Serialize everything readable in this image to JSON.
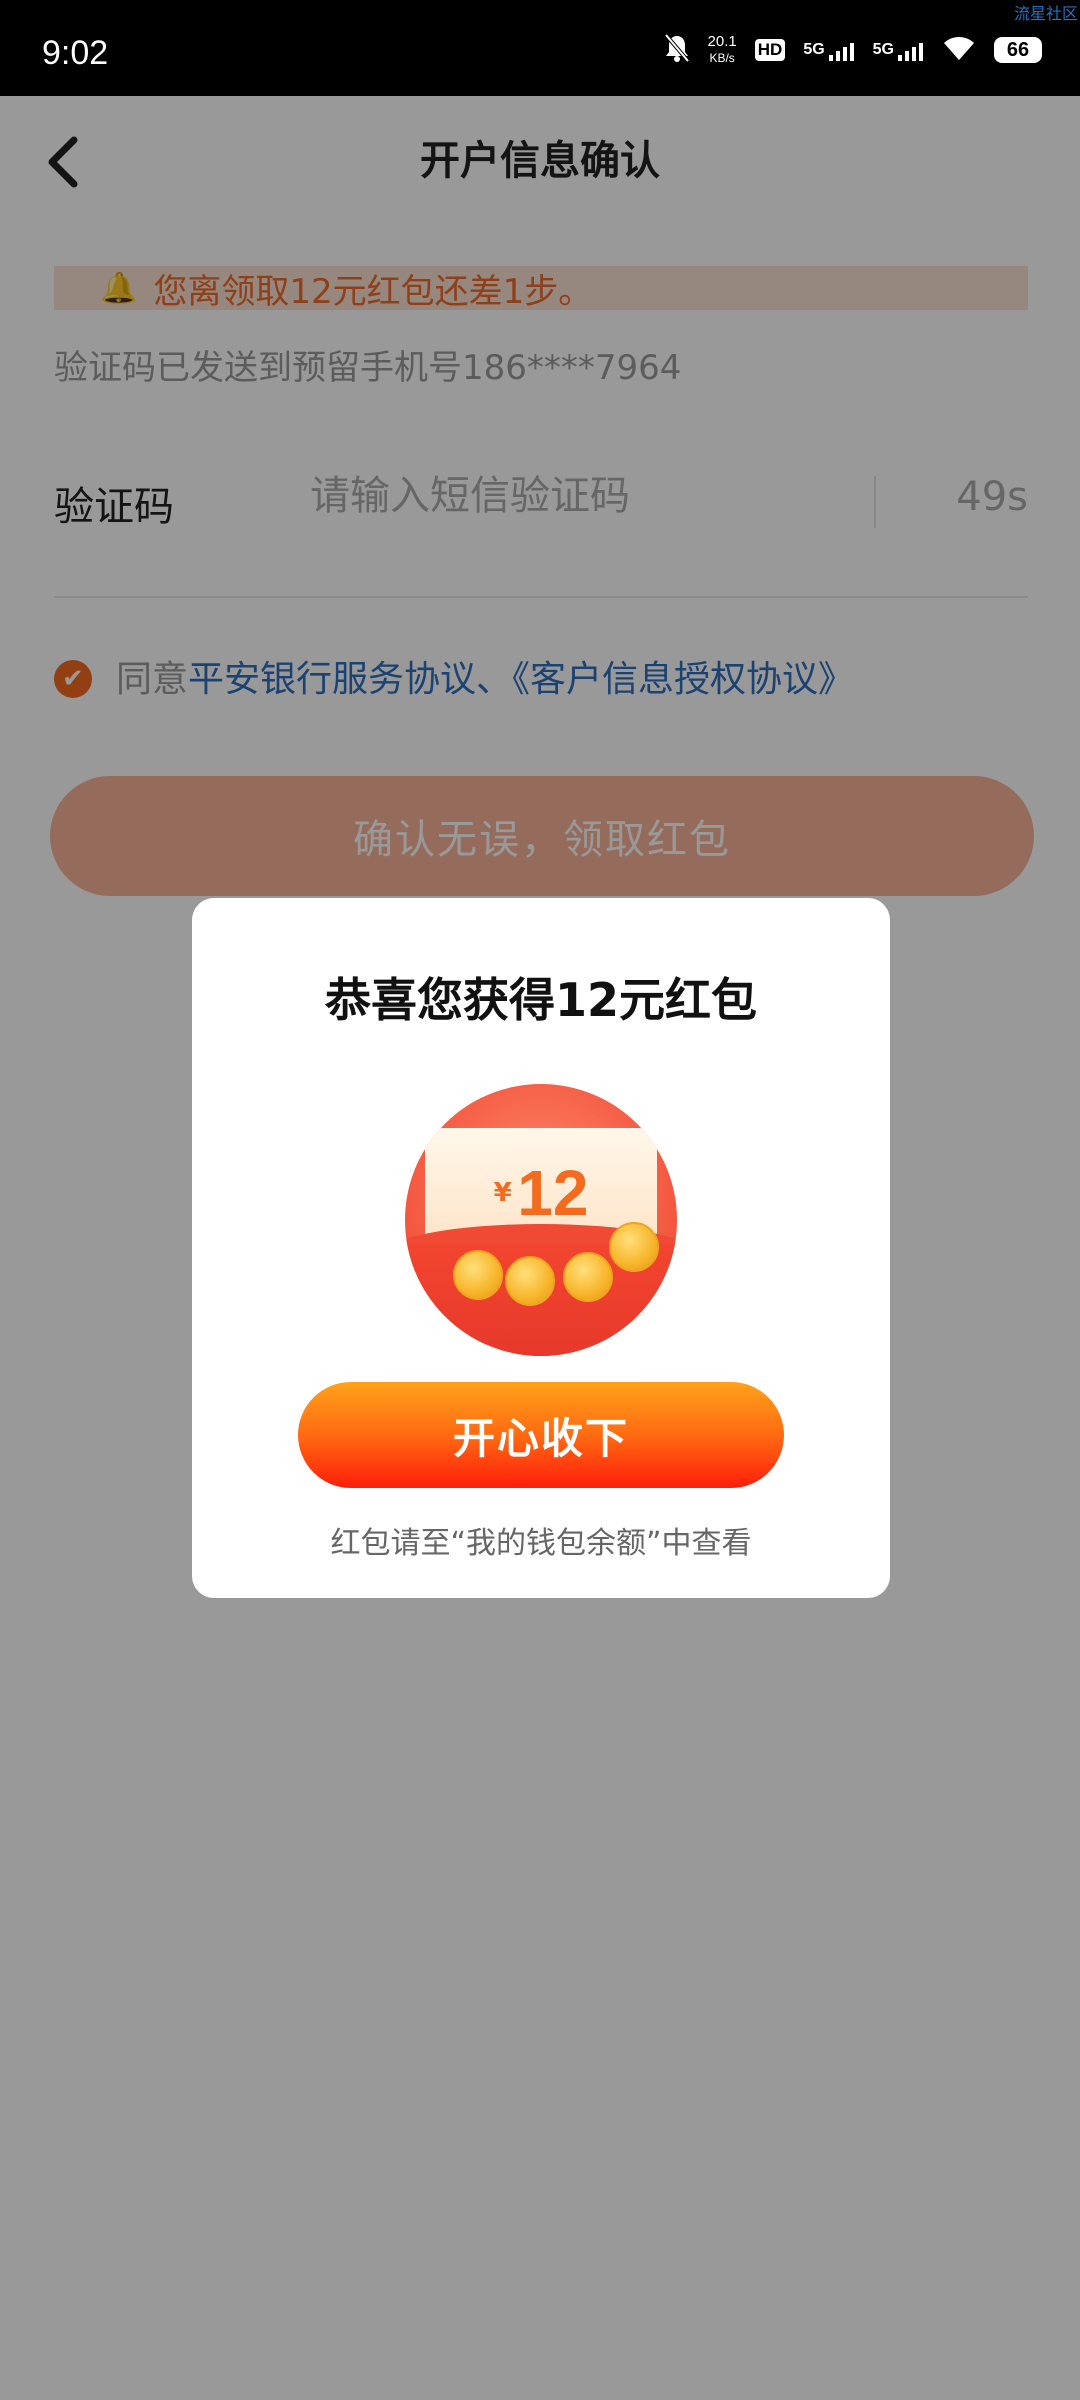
{
  "status_bar": {
    "time": "9:02",
    "net_speed_value": "20.1",
    "net_speed_unit": "KB/s",
    "hd_label": "HD",
    "sim1_label": "5G",
    "sim2_label": "5G",
    "battery": "66",
    "watermark": "流星社区"
  },
  "header": {
    "title": "开户信息确认"
  },
  "promo": {
    "text": "您离领取12元红包还差1步。"
  },
  "sms_notice": "验证码已发送到预留手机号186****7964",
  "verification": {
    "label": "验证码",
    "value": "",
    "placeholder": "请输入短信验证码",
    "countdown": "49s"
  },
  "agreement": {
    "prefix": "同意",
    "links": "平安银行服务协议、《客户信息授权协议》",
    "checked": true
  },
  "confirm_button": {
    "label": "确认无误，领取红包"
  },
  "modal": {
    "title": "恭喜您获得12元红包",
    "envelope_currency": "¥",
    "envelope_amount": "12",
    "accept_label": "开心收下",
    "note": "红包请至“我的钱包余额”中查看"
  },
  "colors": {
    "accent_orange": "#f26a21",
    "link_blue": "#2f6fbf",
    "promo_bg": "#fbe3d3",
    "overlay": "rgba(0,0,0,0.40)"
  }
}
